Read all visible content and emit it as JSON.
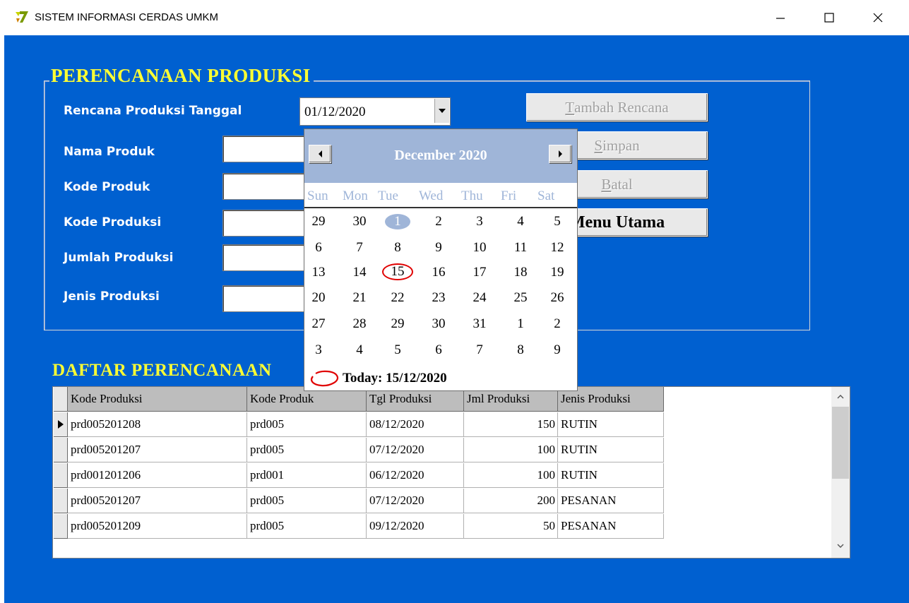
{
  "window": {
    "title": "SISTEM INFORMASI CERDAS UMKM",
    "icons": [
      "app-logo-icon",
      "minimize-icon",
      "maximize-icon",
      "close-icon"
    ]
  },
  "form": {
    "group_title": "PERENCANAAN PRODUKSI",
    "date_label": "Rencana Produksi Tanggal",
    "date_value": "01/12/2020",
    "fields": {
      "nama_produk": "Nama Produk",
      "kode_produk": "Kode Produk",
      "kode_produksi": "Kode Produksi",
      "jumlah_produksi": "Jumlah Produksi",
      "jenis_produksi": "Jenis Produksi"
    },
    "buttons": {
      "tambah": {
        "u": "T",
        "rest": "ambah Rencana"
      },
      "simpan": {
        "u": "S",
        "rest": "impan"
      },
      "batal": {
        "u": "B",
        "rest": "atal"
      },
      "menu": "Menu Utama"
    }
  },
  "calendar": {
    "month_label": "December 2020",
    "weekdays": [
      "Sun",
      "Mon",
      "Tue",
      "Wed",
      "Thu",
      "Fri",
      "Sat"
    ],
    "weeks": [
      [
        "29",
        "30",
        "1",
        "2",
        "3",
        "4",
        "5"
      ],
      [
        "6",
        "7",
        "8",
        "9",
        "10",
        "11",
        "12"
      ],
      [
        "13",
        "14",
        "15",
        "16",
        "17",
        "18",
        "19"
      ],
      [
        "20",
        "21",
        "22",
        "23",
        "24",
        "25",
        "26"
      ],
      [
        "27",
        "28",
        "29",
        "30",
        "31",
        "1",
        "2"
      ],
      [
        "3",
        "4",
        "5",
        "6",
        "7",
        "8",
        "9"
      ]
    ],
    "selected_day": "1",
    "today_day": "15",
    "today_label": "Today: 15/12/2020"
  },
  "list": {
    "title": "DAFTAR PERENCANAAN",
    "columns": [
      "Kode Produksi",
      "Kode Produk",
      "Tgl Produksi",
      "Jml Produksi",
      "Jenis Produksi"
    ],
    "rows": [
      [
        "prd005201208",
        "prd005",
        "08/12/2020",
        "150",
        "RUTIN"
      ],
      [
        "prd005201207",
        "prd005",
        "07/12/2020",
        "100",
        "RUTIN"
      ],
      [
        "prd001201206",
        "prd001",
        "06/12/2020",
        "100",
        "RUTIN"
      ],
      [
        "prd005201207",
        "prd005",
        "07/12/2020",
        "200",
        "PESANAN"
      ],
      [
        "prd005201209",
        "prd005",
        "09/12/2020",
        "50",
        "PESANAN"
      ]
    ]
  },
  "colors": {
    "background": "#0060d0",
    "title_yellow": "#ffff33",
    "calendar_header": "#9fb5d8",
    "today_circle": "#e00000"
  }
}
